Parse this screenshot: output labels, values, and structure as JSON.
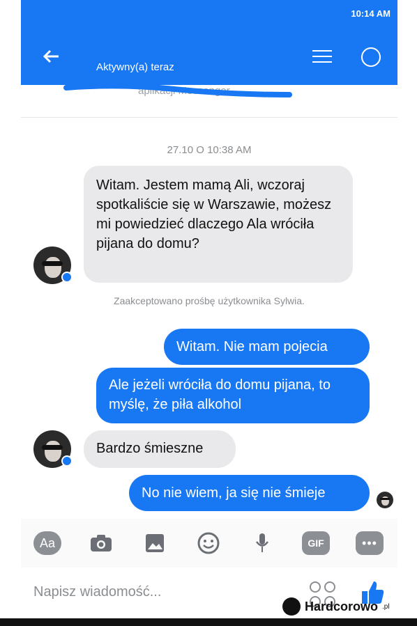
{
  "status_bar": {
    "time": "10:14 AM"
  },
  "header": {
    "presence": "Aktywny(a) teraz",
    "subtitle": "aplikacji Messenger"
  },
  "conversation": {
    "timestamp": "27.10 O 10:38 AM",
    "system_message": "Zaakceptowano prośbę użytkownika Sylwia.",
    "messages": [
      {
        "sender": "incoming",
        "text": "Witam. Jestem mamą Ali, wczoraj spotkaliście się w Warszawie, możesz mi powiedzieć dlaczego Ala wróciła pijana do domu?"
      },
      {
        "sender": "outgoing",
        "text": "Witam. Nie mam pojecia"
      },
      {
        "sender": "outgoing",
        "text": "Ale jeżeli wróciła do domu pijana, to myślę, że piła alkohol"
      },
      {
        "sender": "incoming",
        "text": "Bardzo śmieszne"
      },
      {
        "sender": "outgoing",
        "text": "No nie wiem, ja się nie śmieje"
      }
    ]
  },
  "toolbar": {
    "aa_label": "Aa",
    "gif_label": "GIF",
    "more_label": "•••",
    "icons": [
      "camera-icon",
      "image-icon",
      "emoji-icon",
      "mic-icon"
    ]
  },
  "composer": {
    "placeholder": "Napisz wiadomość..."
  },
  "watermark": {
    "brand": "Hardcorowo",
    "tld": ".pl"
  },
  "colors": {
    "accent": "#1877f2",
    "incoming_bubble": "#e9e9eb",
    "outgoing_bubble": "#1877f2"
  }
}
